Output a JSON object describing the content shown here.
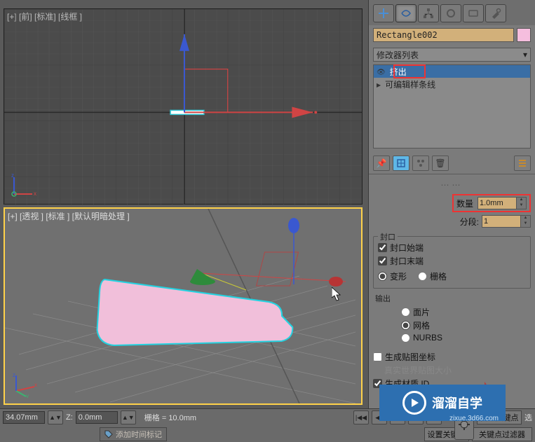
{
  "viewport_top_label": "[+] [前] [标准] [线框 ]",
  "viewport_persp_label": "[+] [透视 ] [标准 ] [默认明暗处理 ]",
  "right_panel": {
    "object_name": "Rectangle002",
    "modifier_dropdown": "修改器列表",
    "stack": {
      "extrude": "挤出",
      "editable_spline": "可编辑样条线"
    },
    "params": {
      "amount_label": "数量",
      "amount_value": "1.0mm",
      "segments_label": "分段:",
      "segments_value": "1"
    },
    "cap_group": {
      "title": "封口",
      "cap_start": "封口始端",
      "cap_end": "封口末端",
      "morph": "变形",
      "grid": "栅格"
    },
    "output_group": {
      "title": "输出",
      "patch": "面片",
      "mesh": "网格",
      "nurbs": "NURBS"
    },
    "gen_map": "生成贴图坐标",
    "real_world": "真实世界贴图大小",
    "gen_mat_id": "生成材质 ID"
  },
  "bottom": {
    "x_value": "34.07mm",
    "z_label": "Z:",
    "z_value": "0.0mm",
    "grid_label": "栅格 = 10.0mm",
    "add_time_tag": "添加时间标记",
    "auto_key": "自动关键点",
    "set_key": "设置关键点",
    "selected_label": "选",
    "key_filter": "关键点过滤器"
  },
  "watermark": {
    "brand": "溜溜自学",
    "url": "zixue.3d66.com"
  }
}
